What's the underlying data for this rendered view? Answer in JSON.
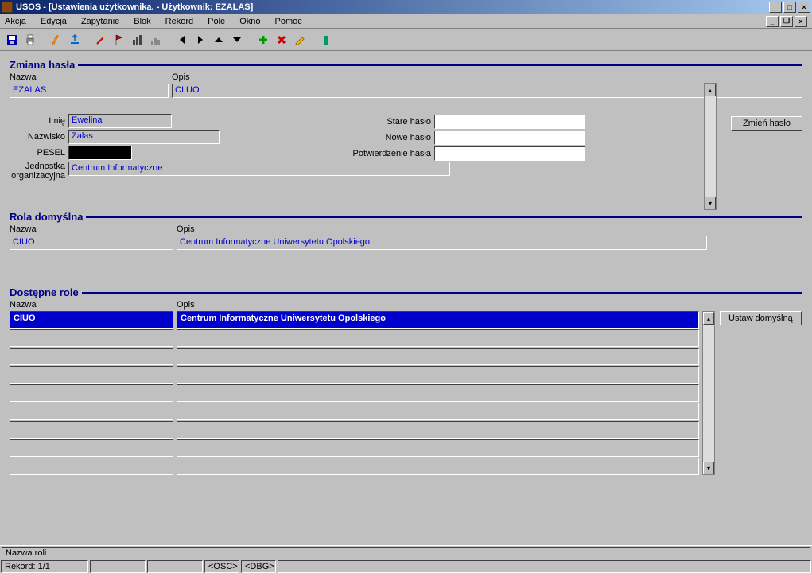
{
  "window": {
    "title": "USOS - [Ustawienia użytkownika. - Użytkownik: EZALAS]"
  },
  "menu": {
    "akcja": "Akcja",
    "edycja": "Edycja",
    "zapytanie": "Zapytanie",
    "blok": "Blok",
    "rekord": "Rekord",
    "pole": "Pole",
    "okno": "Okno",
    "pomoc": "Pomoc"
  },
  "sections": {
    "zmiana_hasla": "Zmiana hasła",
    "rola_domyslna": "Rola domyślna",
    "dostepne_role": "Dostępne role"
  },
  "labels": {
    "nazwa": "Nazwa",
    "opis": "Opis",
    "imie": "Imię",
    "nazwisko": "Nazwisko",
    "pesel": "PESEL",
    "jednostka": "Jednostka organizacyjna",
    "stare_haslo": "Stare hasło",
    "nowe_haslo": "Nowe hasło",
    "potwierdzenie": "Potwierdzenie hasła"
  },
  "user": {
    "nazwa": "EZALAS",
    "opis": "CI UO",
    "imie": "Ewelina",
    "nazwisko": "Zalas",
    "pesel": "",
    "jednostka": "Centrum Informatyczne"
  },
  "buttons": {
    "zmien_haslo": "Zmień hasło",
    "ustaw_domyslna": "Ustaw domyślną"
  },
  "default_role": {
    "nazwa": "CIUO",
    "opis": "Centrum Informatyczne Uniwersytetu Opolskiego"
  },
  "roles": [
    {
      "nazwa": "CIUO",
      "opis": "Centrum Informatyczne Uniwersytetu Opolskiego"
    },
    {
      "nazwa": "",
      "opis": ""
    },
    {
      "nazwa": "",
      "opis": ""
    },
    {
      "nazwa": "",
      "opis": ""
    },
    {
      "nazwa": "",
      "opis": ""
    },
    {
      "nazwa": "",
      "opis": ""
    },
    {
      "nazwa": "",
      "opis": ""
    },
    {
      "nazwa": "",
      "opis": ""
    },
    {
      "nazwa": "",
      "opis": ""
    }
  ],
  "status": {
    "message": "Nazwa roli",
    "record": "Rekord: 1/1",
    "osc": "<OSC>",
    "dbg": "<DBG>"
  }
}
